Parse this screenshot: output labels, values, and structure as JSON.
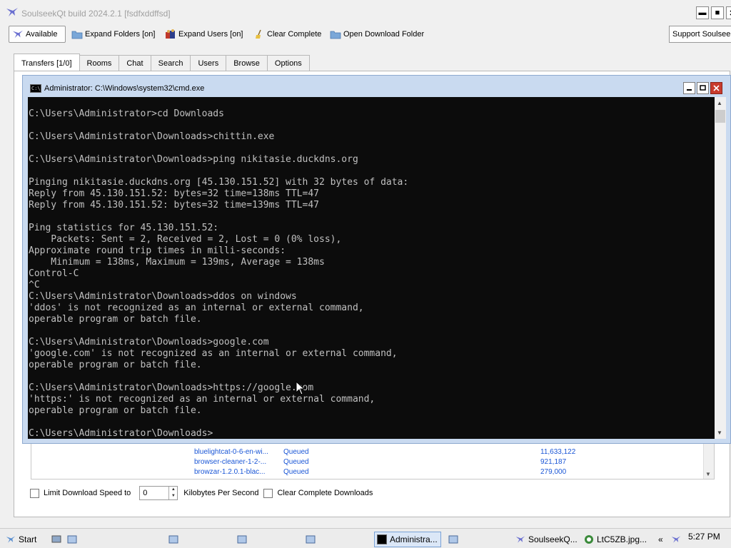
{
  "app": {
    "title": "SoulseekQt build 2024.2.1 [fsdfxddffsd]",
    "window_min": "▬",
    "window_max": "■",
    "window_close": "✕"
  },
  "toolbar": {
    "available_label": "Available",
    "expand_folders_label": "Expand Folders [on]",
    "expand_users_label": "Expand Users [on]",
    "clear_complete_label": "Clear Complete",
    "open_download_folder_label": "Open Download Folder",
    "support_label": "Support Soulseek"
  },
  "tabs": [
    "Transfers [1/0]",
    "Rooms",
    "Chat",
    "Search",
    "Users",
    "Browse",
    "Options"
  ],
  "downloads": [
    {
      "file": "bluelightcat-0-6-en-wi...",
      "status": "Queued",
      "size": "11,633,122"
    },
    {
      "file": "browser-cleaner-1-2-...",
      "status": "Queued",
      "size": "921,187"
    },
    {
      "file": "browzar-1.2.0.1-blac...",
      "status": "Queued",
      "size": "279,000"
    }
  ],
  "options": {
    "limit_speed_label": "Limit Download Speed to",
    "speed_value": "0",
    "speed_unit": "Kilobytes Per Second",
    "clear_complete_downloads_label": "Clear Complete Downloads"
  },
  "cmd": {
    "title": "Administrator: C:\\Windows\\system32\\cmd.exe",
    "icon_text": "C:\\",
    "lines": [
      "",
      "C:\\Users\\Administrator>cd Downloads",
      "",
      "C:\\Users\\Administrator\\Downloads>chittin.exe",
      "",
      "C:\\Users\\Administrator\\Downloads>ping nikitasie.duckdns.org",
      "",
      "Pinging nikitasie.duckdns.org [45.130.151.52] with 32 bytes of data:",
      "Reply from 45.130.151.52: bytes=32 time=138ms TTL=47",
      "Reply from 45.130.151.52: bytes=32 time=139ms TTL=47",
      "",
      "Ping statistics for 45.130.151.52:",
      "    Packets: Sent = 2, Received = 2, Lost = 0 (0% loss),",
      "Approximate round trip times in milli-seconds:",
      "    Minimum = 138ms, Maximum = 139ms, Average = 138ms",
      "Control-C",
      "^C",
      "C:\\Users\\Administrator\\Downloads>ddos on windows",
      "'ddos' is not recognized as an internal or external command,",
      "operable program or batch file.",
      "",
      "C:\\Users\\Administrator\\Downloads>google.com",
      "'google.com' is not recognized as an internal or external command,",
      "operable program or batch file.",
      "",
      "C:\\Users\\Administrator\\Downloads>https://google.com",
      "'https:' is not recognized as an internal or external command,",
      "operable program or batch file.",
      "",
      "C:\\Users\\Administrator\\Downloads>"
    ]
  },
  "taskbar": {
    "start_label": "Start",
    "cmd_task_label": "Administra...",
    "soulseek_task_label": "SoulseekQ...",
    "image_task_label": "LtC5ZB.jpg...",
    "overflow_label": "«",
    "clock": "5:27 PM"
  }
}
